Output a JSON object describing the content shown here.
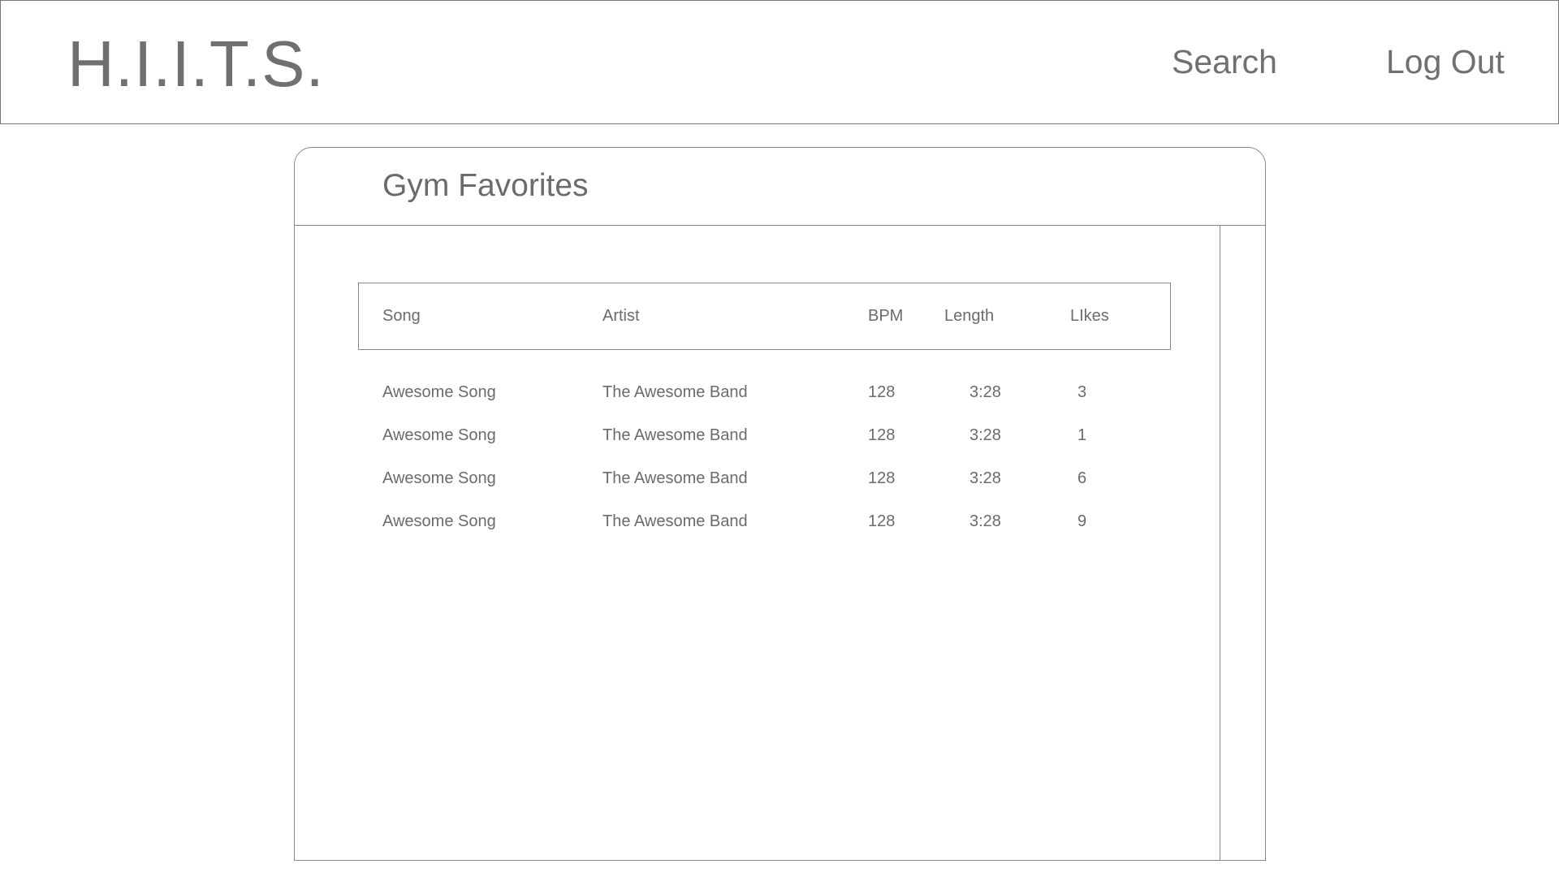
{
  "header": {
    "logo": "H.I.I.T.S.",
    "nav": {
      "search": "Search",
      "logout": "Log Out"
    }
  },
  "playlist": {
    "title": "Gym Favorites",
    "columns": [
      "Song",
      "Artist",
      "BPM",
      "Length",
      "LIkes"
    ],
    "rows": [
      {
        "song": "Awesome Song",
        "artist": "The Awesome Band",
        "bpm": "128",
        "length": "3:28",
        "likes": "3"
      },
      {
        "song": "Awesome Song",
        "artist": "The Awesome Band",
        "bpm": "128",
        "length": "3:28",
        "likes": "1"
      },
      {
        "song": "Awesome Song",
        "artist": "The Awesome Band",
        "bpm": "128",
        "length": "3:28",
        "likes": "6"
      },
      {
        "song": "Awesome Song",
        "artist": "The Awesome Band",
        "bpm": "128",
        "length": "3:28",
        "likes": "9"
      }
    ]
  }
}
